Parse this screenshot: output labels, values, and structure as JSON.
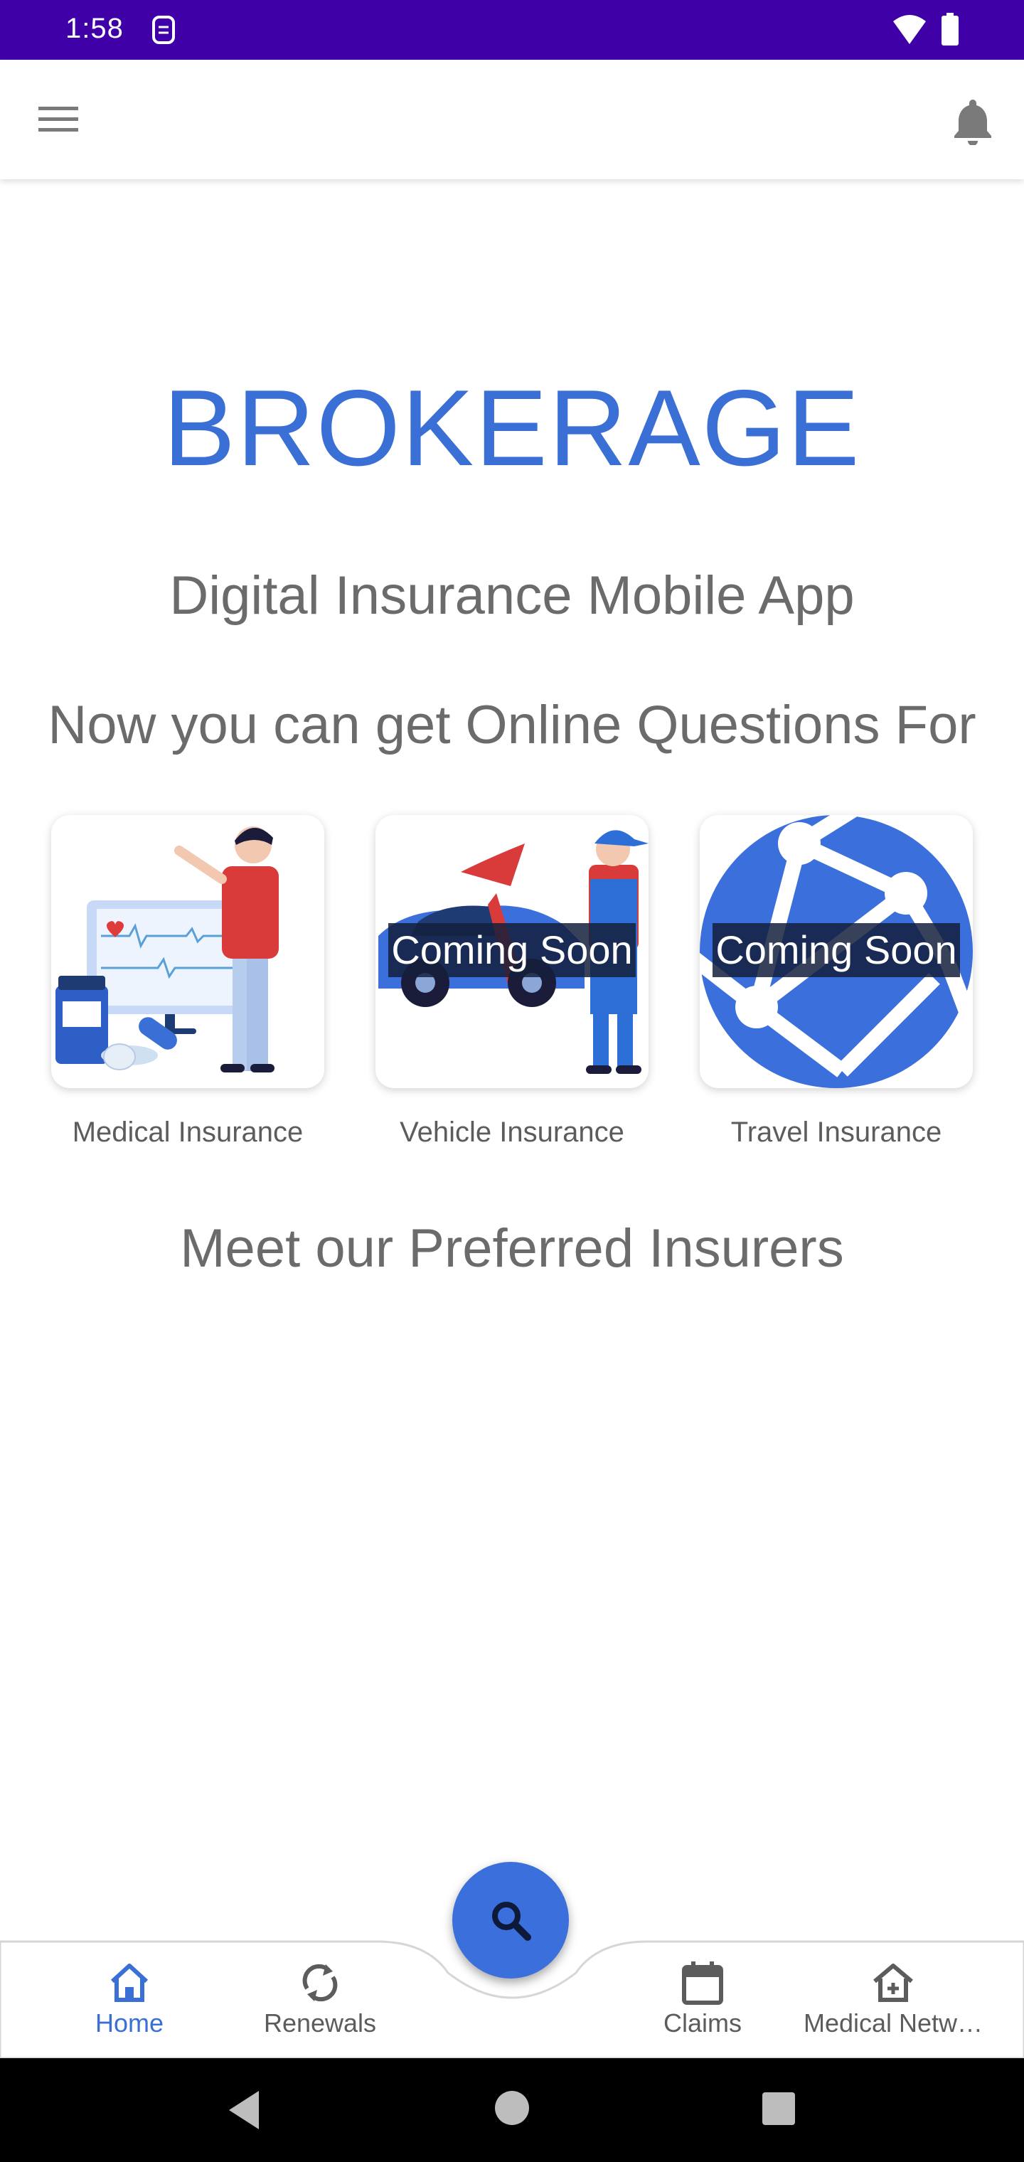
{
  "status_bar": {
    "time": "1:58"
  },
  "header": {},
  "main": {
    "brand": "BROKERAGE",
    "subtitle": "Digital Insurance Mobile App",
    "intro": "Now you can get Online Questions For",
    "cards": [
      {
        "label": "Medical Insurance",
        "overlay": ""
      },
      {
        "label": "Vehicle Insurance",
        "overlay": "Coming Soon"
      },
      {
        "label": "Travel Insurance",
        "overlay": "Coming Soon"
      }
    ],
    "preferred_title": "Meet our Preferred Insurers"
  },
  "bottom_nav": {
    "items": [
      {
        "label": "Home",
        "icon": "home-icon",
        "active": true
      },
      {
        "label": "Renewals",
        "icon": "refresh-icon",
        "active": false
      },
      {
        "label": "Claims",
        "icon": "calendar-icon",
        "active": false
      },
      {
        "label": "Medical Netw…",
        "icon": "medical-home-icon",
        "active": false
      }
    ],
    "fab_icon": "search-icon"
  },
  "colors": {
    "status_bar": "#3f00a8",
    "brand": "#3a6fd6",
    "active_nav": "#3a6fd6",
    "fab": "#3b6fdc",
    "text_muted": "#6b6b6b"
  }
}
